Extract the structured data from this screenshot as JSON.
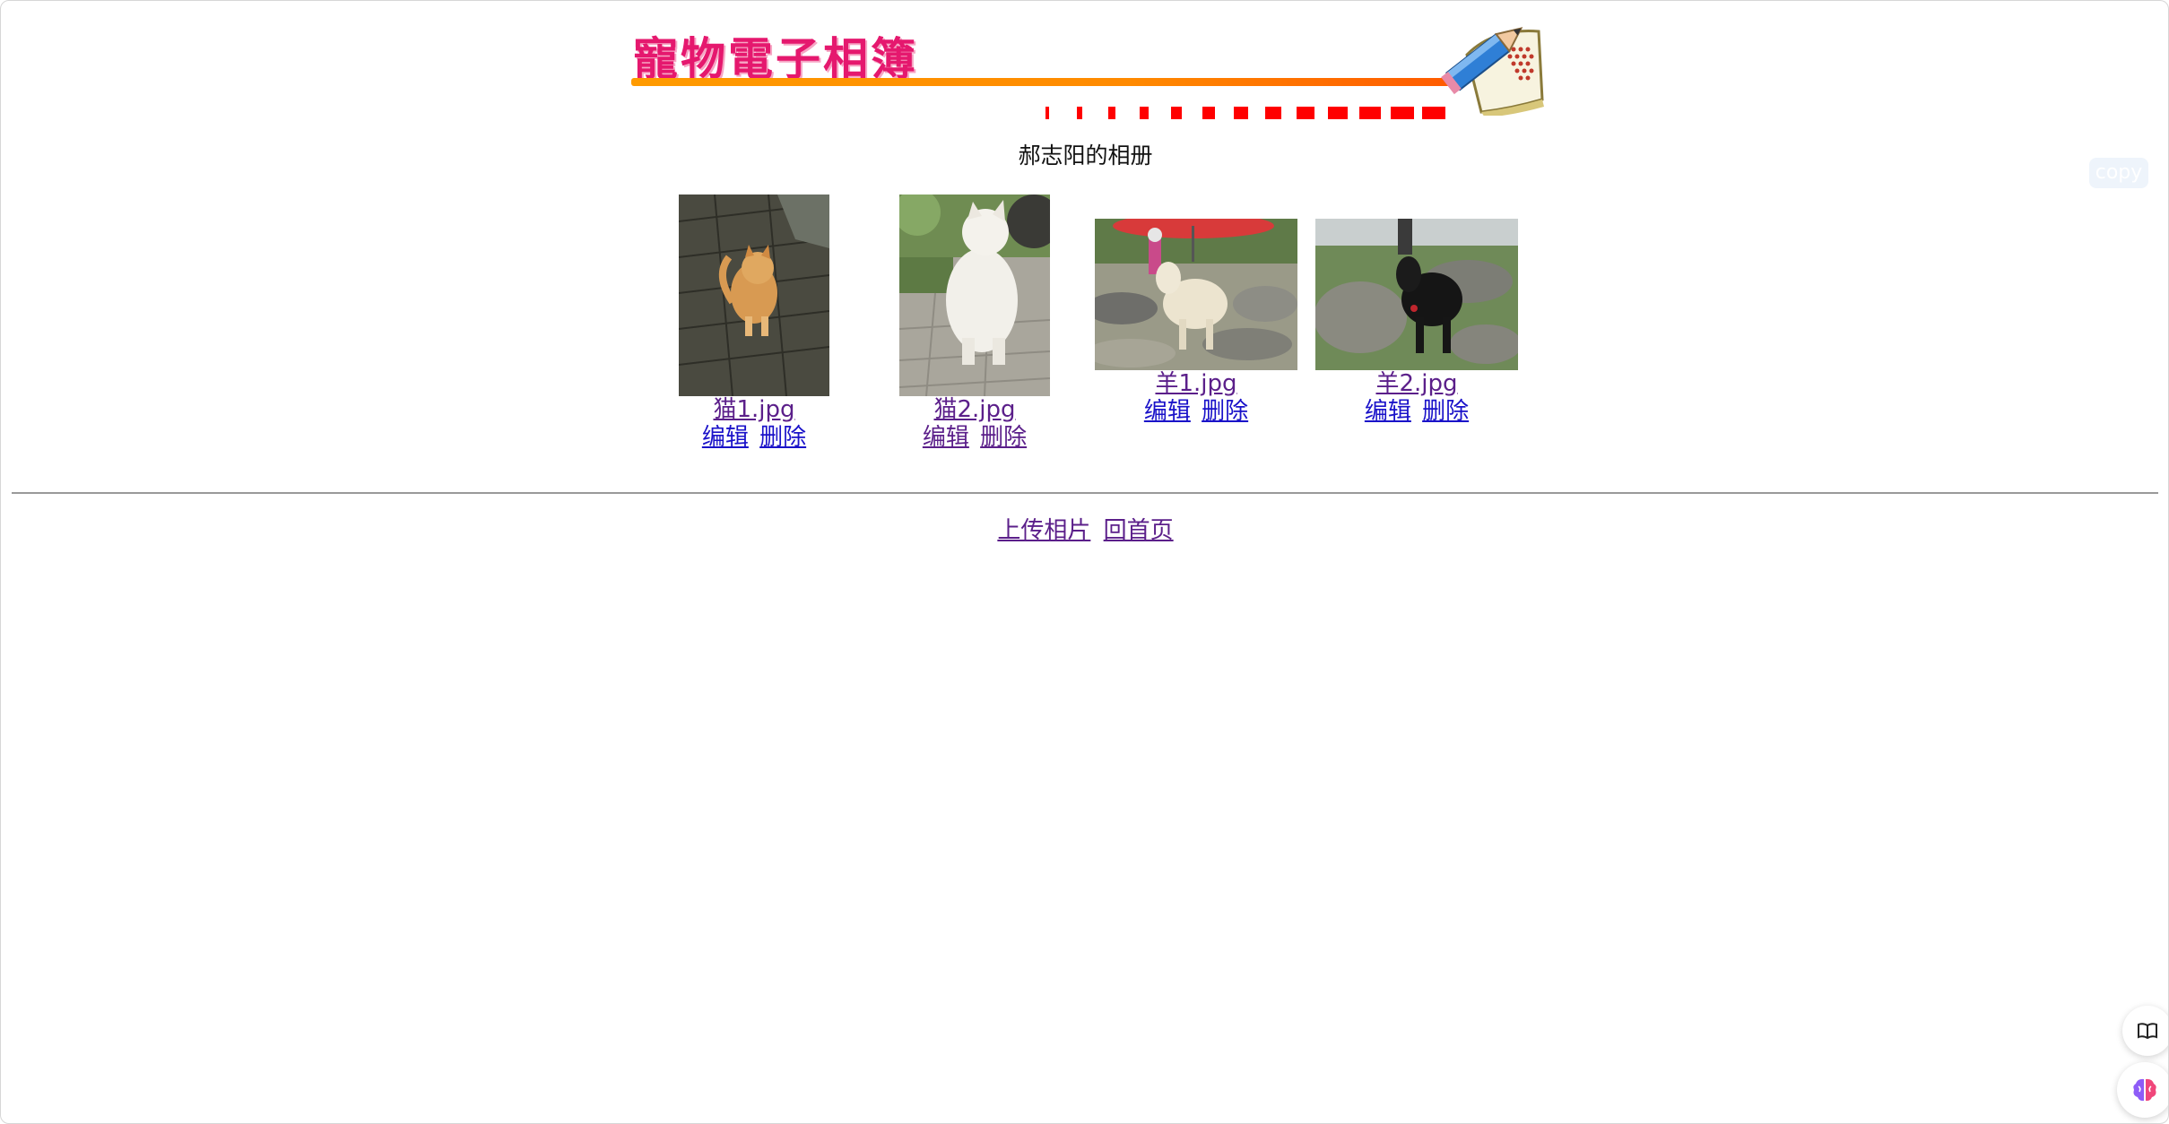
{
  "banner": {
    "title": "寵物電子相簿",
    "colors": {
      "title": "#e5186e",
      "line": "#ff9b00",
      "dashes": "#ff0000"
    }
  },
  "album": {
    "title": "郝志阳的相册"
  },
  "photos": [
    {
      "filename": "猫1.jpg",
      "edit_label": "编辑",
      "delete_label": "删除",
      "subject": "orange tabby cat on brick pavement"
    },
    {
      "filename": "猫2.jpg",
      "edit_label": "编辑",
      "delete_label": "删除",
      "subject": "white cat sitting on pavement"
    },
    {
      "filename": "羊1.jpg",
      "edit_label": "编辑",
      "delete_label": "删除",
      "subject": "white goat among rocks"
    },
    {
      "filename": "羊2.jpg",
      "edit_label": "编辑",
      "delete_label": "删除",
      "subject": "black goat among rocks"
    }
  ],
  "footer": {
    "upload_label": "上传相片",
    "home_label": "回首页"
  },
  "overlay": {
    "copy_label": "copy",
    "book_icon": "book-open-icon",
    "brain_icon": "brain-icon"
  },
  "link_colors": {
    "visited": "#5b1f8a",
    "unvisited": "#1a12c9"
  }
}
